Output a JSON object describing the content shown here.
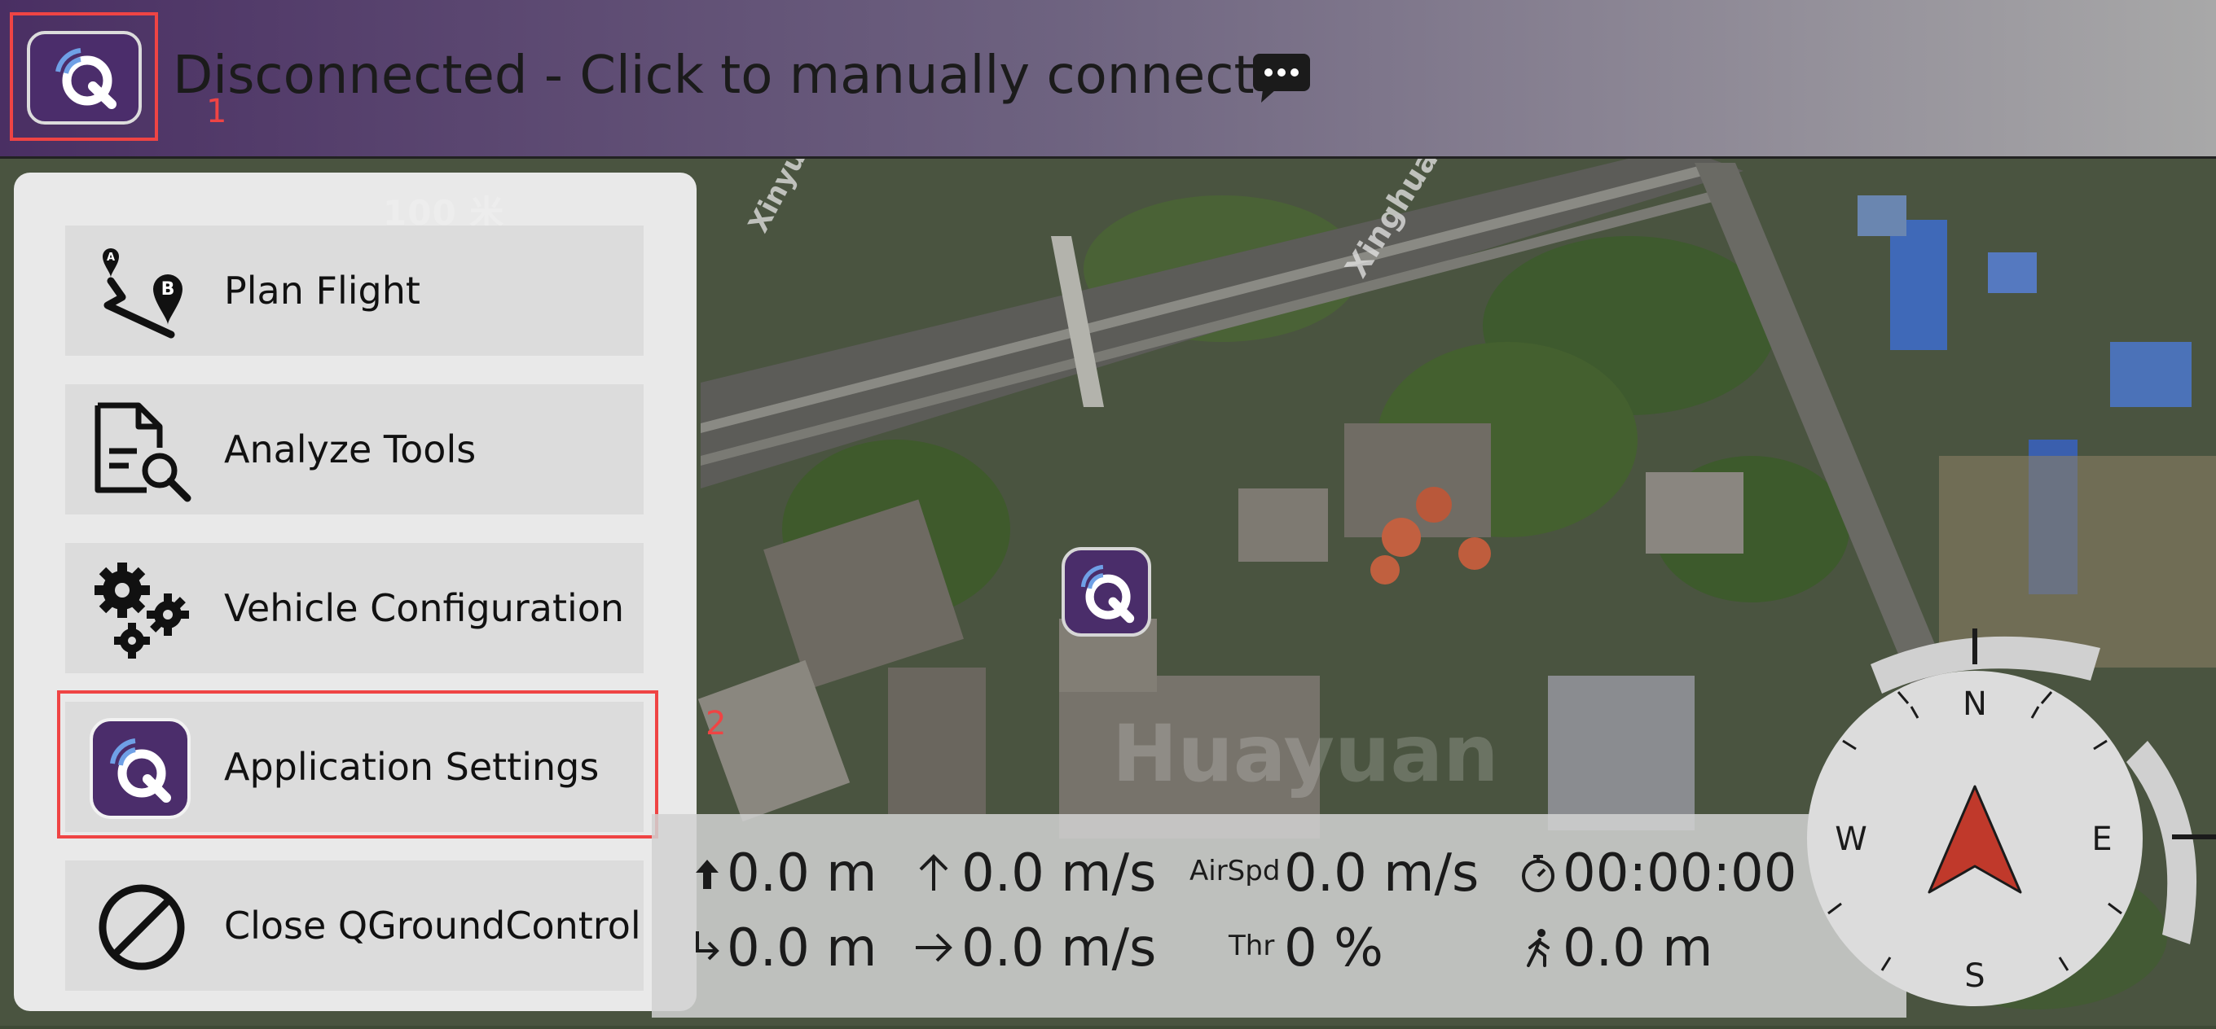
{
  "toolbar": {
    "connection_status": "Disconnected - Click to manually connect",
    "badge_logo": "1"
  },
  "map": {
    "scale": "100 米",
    "labels": [
      "Xinyu",
      "Xinghua",
      "Huayuan"
    ]
  },
  "menu": {
    "items": [
      {
        "label": "Plan Flight",
        "icon": "plan-flight-icon"
      },
      {
        "label": "Analyze Tools",
        "icon": "analyze-tools-icon"
      },
      {
        "label": "Vehicle Configuration",
        "icon": "gears-icon"
      },
      {
        "label": "Application Settings",
        "icon": "qgc-logo-icon"
      },
      {
        "label": "Close QGroundControl",
        "icon": "close-prohibit-icon"
      }
    ],
    "highlight_badge": "2"
  },
  "telemetry": {
    "altitude": "0.0 m",
    "distance": "0.0 m",
    "vertical_speed": "0.0 m/s",
    "horizontal_speed": "0.0 m/s",
    "airspeed_label": "AirSpd",
    "airspeed": "0.0 m/s",
    "throttle_label": "Thr",
    "throttle": "0 %",
    "flight_time": "00:00:00",
    "distance_to_home": "0.0 m"
  },
  "compass": {
    "n": "N",
    "e": "E",
    "s": "S",
    "w": "W"
  },
  "colors": {
    "highlight": "#ef4444",
    "qgc_purple": "#4b2d6b",
    "compass_arrow": "#c0392b"
  }
}
